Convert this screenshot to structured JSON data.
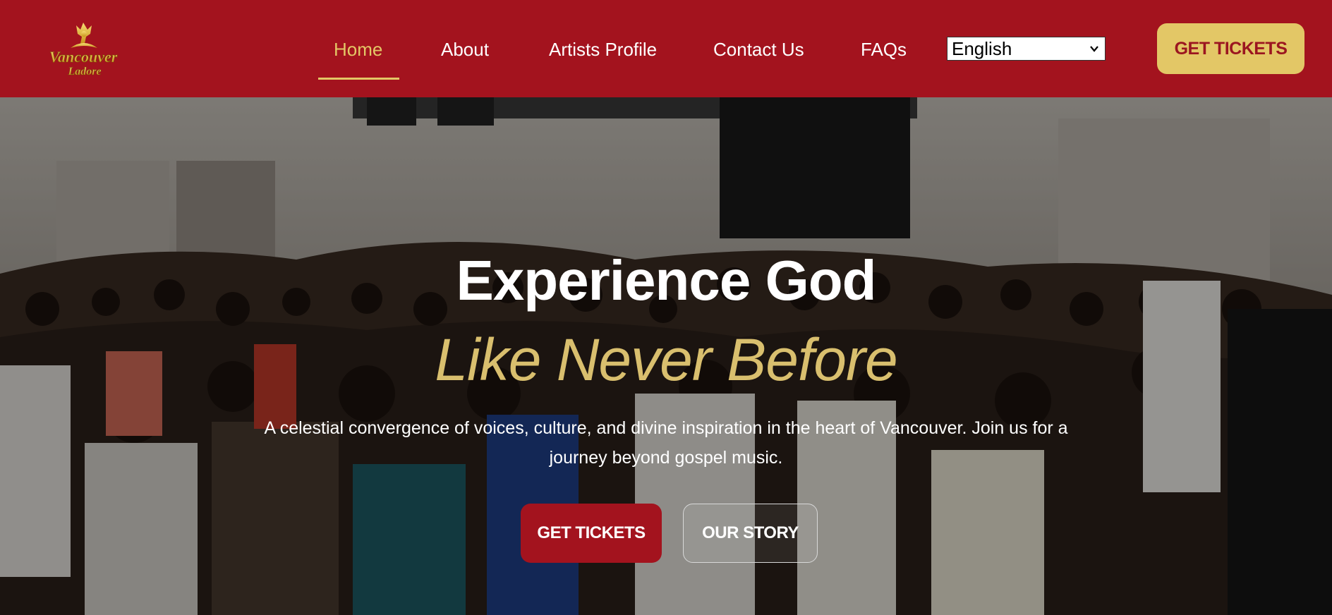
{
  "colors": {
    "header_bg": "#a3131e",
    "accent_gold": "#e3c766",
    "subtitle_gold": "#d9bf6e",
    "cta_text": "#9b1620",
    "primary_button": "#a3131e"
  },
  "logo": {
    "text_line1": "Vancouver",
    "text_line2": "Ladore",
    "icon": "worship-figure-logo"
  },
  "nav": {
    "items": [
      {
        "label": "Home",
        "active": true
      },
      {
        "label": "About",
        "active": false
      },
      {
        "label": "Artists Profile",
        "active": false
      },
      {
        "label": "Contact Us",
        "active": false
      },
      {
        "label": "FAQs",
        "active": false
      }
    ],
    "language": {
      "selected": "English",
      "icon": "chevron-down-icon"
    },
    "cta_label": "GET TICKETS"
  },
  "hero": {
    "title": "Experience God",
    "subtitle": "Like Never Before",
    "description": "A celestial convergence of voices, culture, and divine inspiration in the heart of Vancouver. Join us for a journey beyond gospel music.",
    "primary_button": "GET TICKETS",
    "secondary_button": "OUR STORY",
    "background": "worship-crowd-photo"
  }
}
